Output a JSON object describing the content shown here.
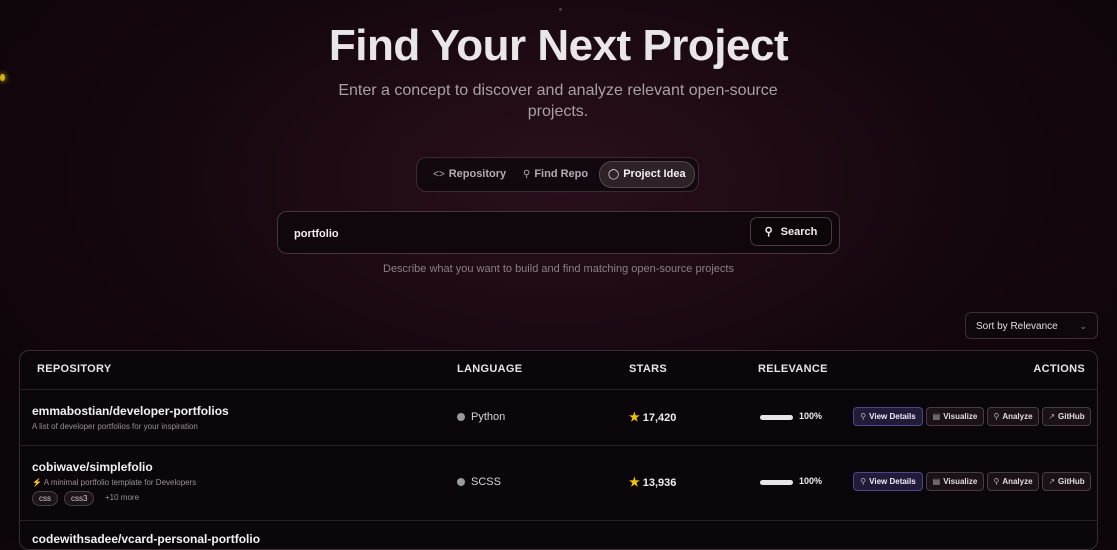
{
  "hero": {
    "title": "Find Your Next Project",
    "subtitle": "Enter a concept to discover and analyze relevant open-source projects."
  },
  "tabs": [
    {
      "label": "Repository",
      "icon": "code-icon"
    },
    {
      "label": "Find Repo",
      "icon": "search-icon"
    },
    {
      "label": "Project Idea",
      "icon": "lightbulb-icon",
      "active": true
    }
  ],
  "search": {
    "value": "portfolio",
    "button_label": "Search",
    "hint": "Describe what you want to build and find matching open-source projects"
  },
  "sort": {
    "selected": "Sort by Relevance"
  },
  "table": {
    "headers": {
      "repository": "REPOSITORY",
      "language": "LANGUAGE",
      "stars": "STARS",
      "relevance": "RELEVANCE",
      "actions": "ACTIONS"
    },
    "actions": {
      "view": "View Details",
      "visualize": "Visualize",
      "analyze": "Analyze",
      "github": "GitHub"
    },
    "rows": [
      {
        "name": "emmabostian/developer-portfolios",
        "description": "A list of developer portfolios for your inspiration",
        "language": "Python",
        "stars": "17,420",
        "relevance": "100%",
        "relevance_fraction": 1.0
      },
      {
        "name": "cobiwave/simplefolio",
        "description": "⚡️ A minimal portfolio template for Developers",
        "language": "SCSS",
        "stars": "13,936",
        "relevance": "100%",
        "relevance_fraction": 1.0,
        "tags": [
          "css",
          "css3"
        ],
        "more": "+10 more"
      },
      {
        "name": "codewithsadee/vcard-personal-portfolio"
      }
    ]
  },
  "colors": {
    "accent_star": "#f2c20f",
    "view_button": "#4e4690"
  }
}
